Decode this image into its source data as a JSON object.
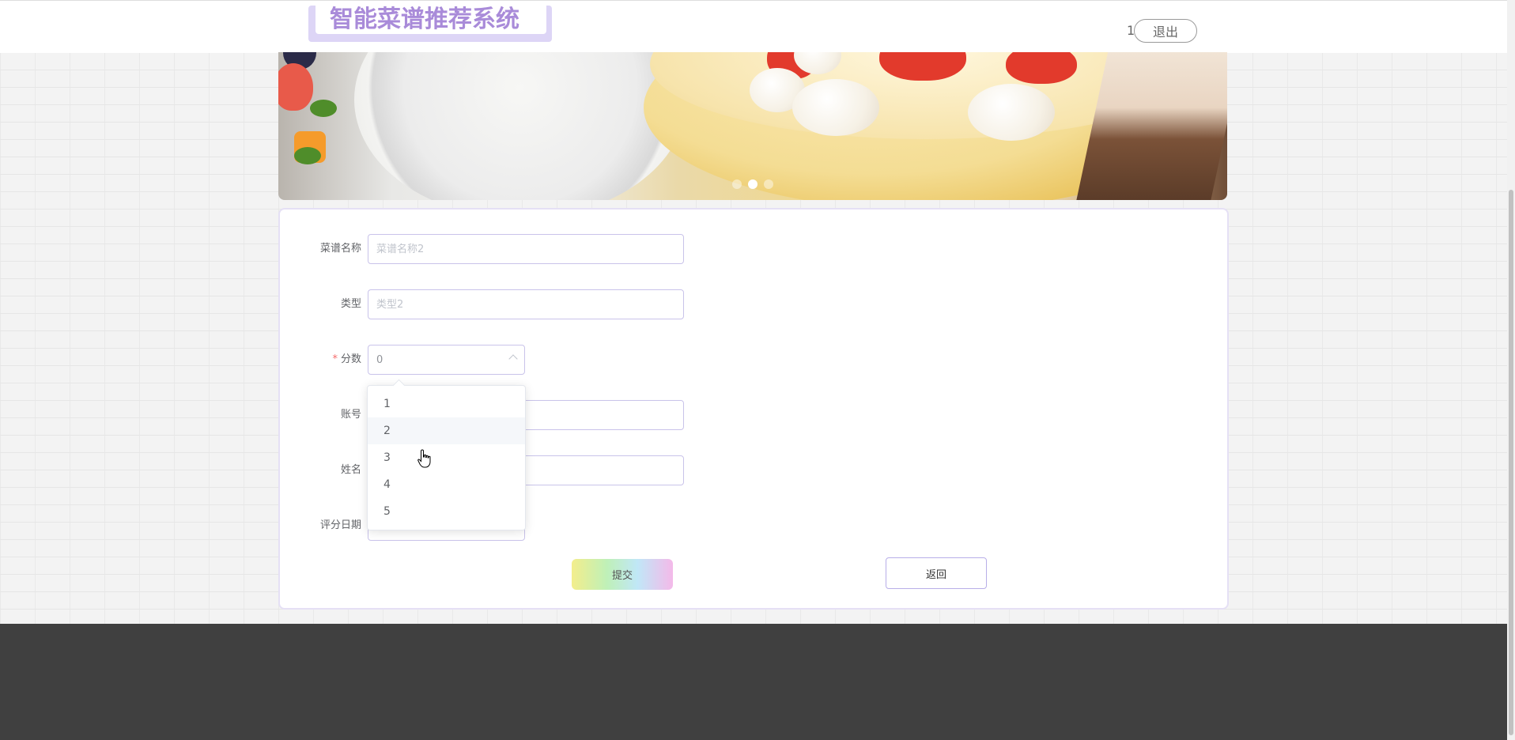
{
  "header": {
    "logo_text": "智能菜谱推荐系统",
    "user_name": "1",
    "logout_label": "退出"
  },
  "banner": {
    "slide_count": 3,
    "active_slide": 2
  },
  "form": {
    "fields": {
      "recipe_name": {
        "label": "菜谱名称",
        "placeholder": "菜谱名称2",
        "value": ""
      },
      "type": {
        "label": "类型",
        "placeholder": "类型2",
        "value": ""
      },
      "score": {
        "label": "分数",
        "value": "0",
        "required": "*"
      },
      "account": {
        "label": "账号",
        "value": ""
      },
      "name": {
        "label": "姓名",
        "value": ""
      },
      "rating_date": {
        "label": "评分日期",
        "value": ""
      }
    },
    "score_options": [
      "1",
      "2",
      "3",
      "4",
      "5"
    ],
    "hovered_option": "2",
    "submit_label": "提交",
    "back_label": "返回"
  },
  "colors": {
    "accent": "#a98bd9",
    "border": "#c9c3ea",
    "footer": "#404040"
  }
}
